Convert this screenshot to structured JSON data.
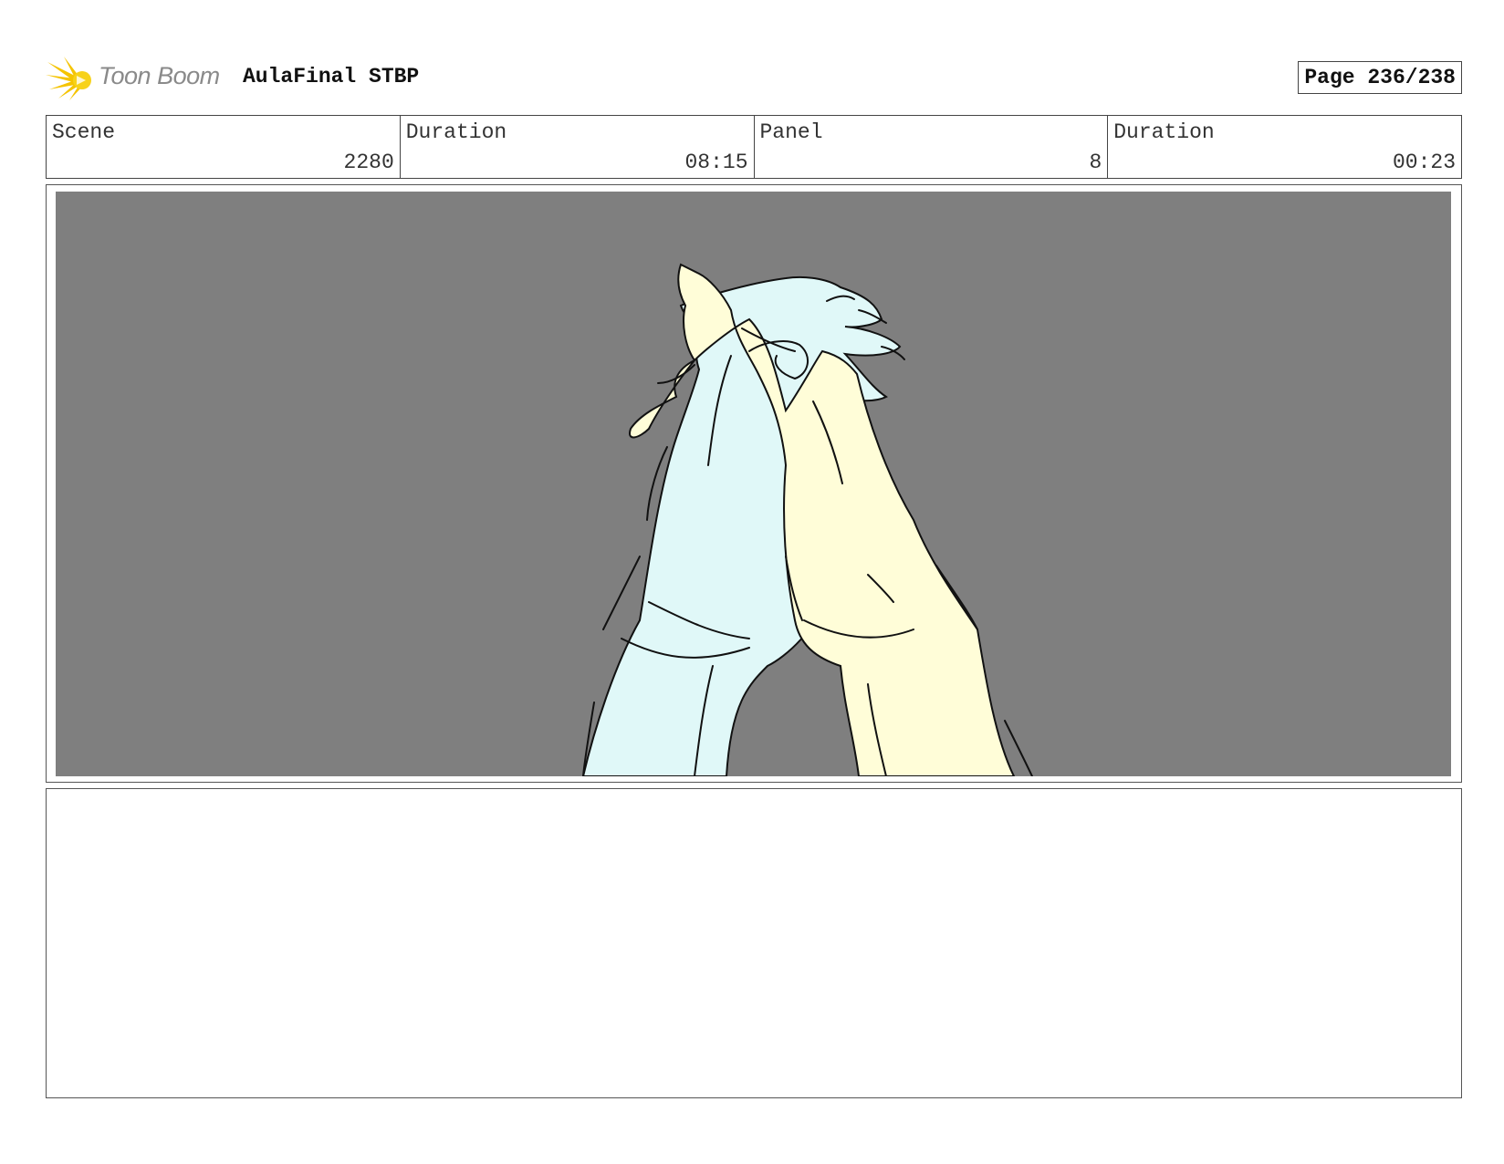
{
  "header": {
    "logo_text": "Toon Boom",
    "title": "AulaFinal STBP",
    "page": "Page 236/238"
  },
  "info": [
    {
      "label": "Scene",
      "value": "2280"
    },
    {
      "label": "Duration",
      "value": "08:15"
    },
    {
      "label": "Panel",
      "value": "8"
    },
    {
      "label": "Duration",
      "value": "00:23"
    }
  ],
  "panel": {
    "background_color": "#7f7f7f",
    "left_hand_color": "#e0f8f8",
    "right_hand_color": "#fffdd8",
    "line_color": "#111111"
  },
  "notes": {
    "action": "",
    "dialogue": ""
  }
}
